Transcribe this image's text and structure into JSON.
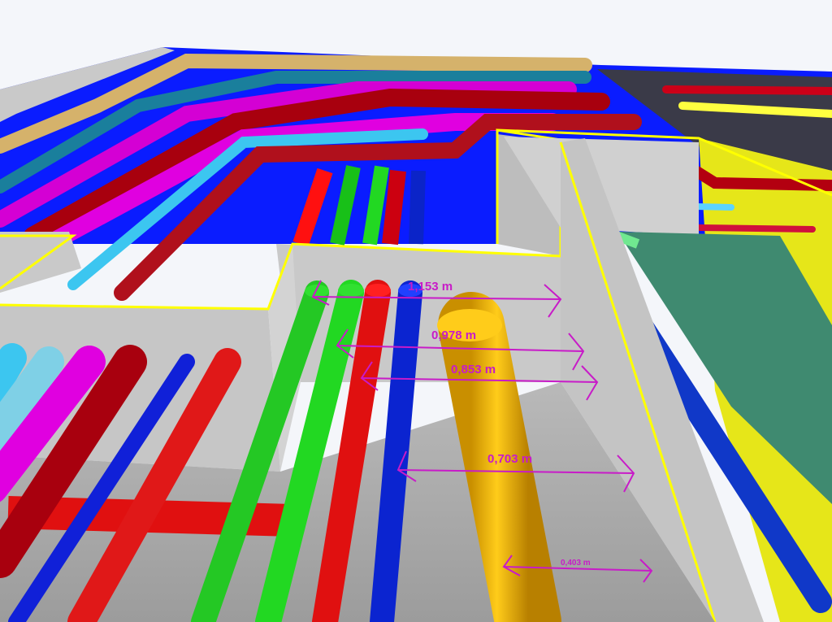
{
  "scene": {
    "background": "#f4f6fa",
    "wall_color": "#c9c9c9",
    "wall_shadow": "#a7a7a7",
    "outline_color": "#ffff00",
    "annotation_color": "#c81bc8"
  },
  "dimensions": [
    {
      "label": "1,153 m"
    },
    {
      "label": "0,978 m"
    },
    {
      "label": "0,853 m"
    },
    {
      "label": "0,703 m"
    },
    {
      "label": "0,403 m"
    }
  ]
}
